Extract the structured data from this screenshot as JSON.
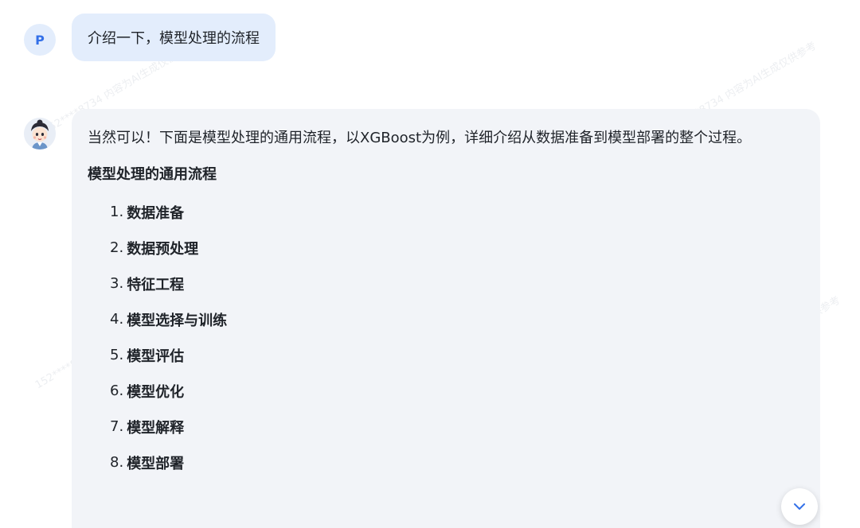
{
  "user": {
    "avatar_letter": "P",
    "message": "介绍一下，模型处理的流程"
  },
  "assistant": {
    "avatar_icon": "character-avatar-icon",
    "intro": "当然可以！下面是模型处理的通用流程，以XGBoost为例，详细介绍从数据准备到模型部署的整个过程。",
    "section_title": "模型处理的通用流程",
    "steps": [
      {
        "num": "1.",
        "label": "数据准备"
      },
      {
        "num": "2.",
        "label": "数据预处理"
      },
      {
        "num": "3.",
        "label": "特征工程"
      },
      {
        "num": "4.",
        "label": "模型选择与训练"
      },
      {
        "num": "5.",
        "label": "模型评估"
      },
      {
        "num": "6.",
        "label": "模型优化"
      },
      {
        "num": "7.",
        "label": "模型解释"
      },
      {
        "num": "8.",
        "label": "模型部署"
      }
    ]
  },
  "watermark_text": "152****8734 内容为AI生成仅供参考",
  "controls": {
    "scroll_down_icon": "chevron-down-icon"
  },
  "colors": {
    "user_bubble": "#e3edfc",
    "assistant_bubble": "#f2f4f8",
    "accent": "#3370e8"
  }
}
